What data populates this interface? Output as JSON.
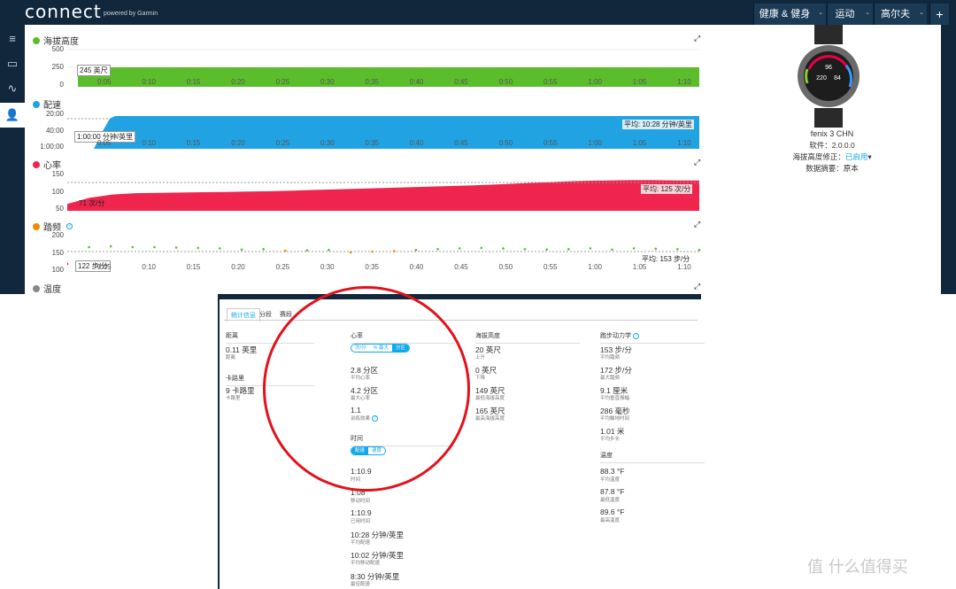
{
  "app": {
    "logo": "connect",
    "logo_sub": "powered by Garmin"
  },
  "topnav": {
    "health": "健康 & 健身",
    "sports": "运动",
    "golf": "高尔夫",
    "plus": "+",
    "arrow": "-"
  },
  "leftnav": [
    "≡",
    "▭",
    "∿",
    "👤"
  ],
  "charts": {
    "elevation": {
      "title": "海拔高度",
      "color": "#5bbd2b",
      "yticks": [
        "500",
        "250",
        "0"
      ],
      "value_label": "245 英尺",
      "values": [
        245,
        245,
        245,
        245,
        245,
        245,
        245,
        245,
        245,
        245,
        245,
        245,
        245,
        245,
        245
      ]
    },
    "pace": {
      "title": "配速",
      "color": "#21a3e3",
      "yticks": [
        "20:00",
        "40:00",
        "1:00:00"
      ],
      "value_label": "1:00:00 分钟/英里",
      "avg_label": "平均: 10:28 分钟/英里"
    },
    "heartrate": {
      "title": "心率",
      "color": "#f0254e",
      "yticks": [
        "150",
        "100",
        "50"
      ],
      "value_label": "71 次/分",
      "avg_label": "平均: 125 次/分",
      "values": [
        71,
        90,
        100,
        104,
        105,
        106,
        107,
        108,
        109,
        110,
        112,
        114,
        116,
        118,
        120,
        122,
        124,
        126,
        128,
        131,
        134,
        137,
        140,
        142,
        143,
        144,
        144,
        143,
        143
      ]
    },
    "cadence": {
      "title": "踏频",
      "color": "#f08a00",
      "yticks": [
        "200",
        "150",
        "100"
      ],
      "value_label": "122 步/分",
      "avg_label": "平均: 153 步/分"
    },
    "temperature": {
      "title": "温度",
      "color": "#888888"
    },
    "xticks": [
      "0:05",
      "0:10",
      "0:15",
      "0:20",
      "0:25",
      "0:30",
      "0:35",
      "0:40",
      "0:45",
      "0:50",
      "0:55",
      "1:00",
      "1:05",
      "1:10"
    ],
    "expand_icon": "⤢"
  },
  "chart_data": [
    {
      "type": "area",
      "title": "海拔高度",
      "x": [
        "0:00",
        "0:05",
        "0:10",
        "0:15",
        "0:20",
        "0:25",
        "0:30",
        "0:35",
        "0:40",
        "0:45",
        "0:50",
        "0:55",
        "1:00",
        "1:05",
        "1:10"
      ],
      "ylim": [
        0,
        500
      ],
      "series": [
        {
          "values": [
            245,
            245,
            245,
            245,
            245,
            245,
            245,
            245,
            245,
            245,
            245,
            245,
            245,
            245,
            245
          ]
        }
      ]
    },
    {
      "type": "area",
      "title": "心率",
      "ylim": [
        50,
        175
      ],
      "series": [
        {
          "values": [
            71,
            90,
            100,
            104,
            105,
            106,
            107,
            108,
            109,
            110,
            112,
            114,
            116,
            118,
            120,
            122,
            124,
            126,
            128,
            131,
            134,
            137,
            140,
            142,
            143,
            144,
            144,
            143,
            143
          ]
        }
      ]
    },
    {
      "type": "scatter",
      "title": "踏频",
      "ylim": [
        100,
        200
      ],
      "series": [
        {
          "values": [
            122,
            163,
            165,
            163,
            163,
            162,
            161,
            160,
            157,
            158,
            154,
            155,
            156,
            150,
            152,
            153,
            156,
            158,
            160,
            161,
            160,
            158,
            157,
            158,
            160,
            157,
            160,
            159,
            158,
            156
          ]
        }
      ]
    }
  ],
  "device": {
    "name": "fenix 3 CHN",
    "software": "软件：2.0.0.0",
    "elev_corr_label": "海拔高度修正：",
    "elev_corr_value": "已启用",
    "summary": "数据摘要：原本",
    "screen_nums": [
      "96",
      "220",
      "84"
    ]
  },
  "panel": {
    "tabs": [
      "统计信息",
      "分段",
      "赛段"
    ],
    "distance": {
      "title": "距离",
      "value": "0.11 英里",
      "label": "距离"
    },
    "calories": {
      "title": "卡路里",
      "value": "9 卡路里",
      "label": "卡路里"
    },
    "hr": {
      "title": "心率",
      "seg": [
        "次/分",
        "% 最大",
        "分区"
      ],
      "items": [
        {
          "v": "2.8 分区",
          "l": "平均心率"
        },
        {
          "v": "4.2 分区",
          "l": "最大心率"
        },
        {
          "v": "1.1",
          "l": "训练效果"
        }
      ]
    },
    "time": {
      "title": "时间",
      "seg": [
        "配速",
        "速度"
      ],
      "items": [
        {
          "v": "1:10.9",
          "l": "时间"
        },
        {
          "v": "1:08",
          "l": "移动时间"
        },
        {
          "v": "1:10.9",
          "l": "已用时间"
        },
        {
          "v": "10:28 分钟/英里",
          "l": "平均配速"
        },
        {
          "v": "10:02 分钟/英里",
          "l": "平均移动配速"
        },
        {
          "v": "8:30 分钟/英里",
          "l": "最佳配速"
        }
      ]
    },
    "elevation": {
      "title": "海拔高度",
      "items": [
        {
          "v": "20 英尺",
          "l": "上升"
        },
        {
          "v": "0 英尺",
          "l": "下降"
        },
        {
          "v": "149 英尺",
          "l": "最低海拔高度"
        },
        {
          "v": "165 英尺",
          "l": "最高海拔高度"
        }
      ]
    },
    "dynamics": {
      "title": "跑步动力学",
      "items": [
        {
          "v": "153 步/分",
          "l": "平均踏频"
        },
        {
          "v": "172 步/分",
          "l": "最大踏频"
        },
        {
          "v": "9.1 厘米",
          "l": "平均垂直振幅"
        },
        {
          "v": "286 毫秒",
          "l": "平均触地时间"
        },
        {
          "v": "1.01 米",
          "l": "平均步长"
        }
      ]
    },
    "temp": {
      "title": "温度",
      "items": [
        {
          "v": "88.3 °F",
          "l": "平均温度"
        },
        {
          "v": "87.8 °F",
          "l": "最低温度"
        },
        {
          "v": "89.6 °F",
          "l": "最高温度"
        }
      ]
    }
  },
  "watermark": "值 什么值得买"
}
